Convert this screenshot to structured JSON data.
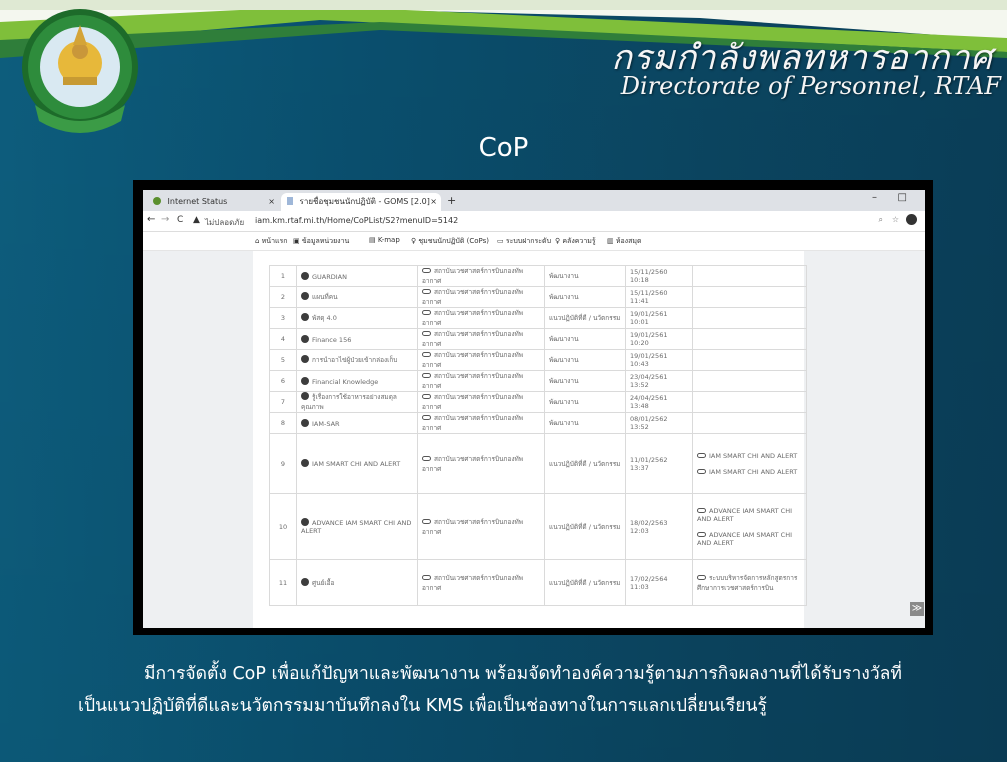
{
  "slide": {
    "org_name_th": "กรมกำลังพลทหารอากาศ",
    "org_name_en": "Directorate of Personnel, RTAF",
    "logo_ring_text": "กรมกำลังพลทหารอากาศ",
    "title": "CoP",
    "caption_line1": "มีการจัดตั้ง CoP เพื่อแก้ปัญหาและพัฒนางาน พร้อมจัดทำองค์ความรู้ตามภารกิจผลงานที่ได้รับรางวัลที่",
    "caption_line2": "เป็นแนวปฏิบัติที่ดีและนวัตกรรมมาบันทึกลงใน KMS  เพื่อเป็นช่องทางในการแลกเปลี่ยนเรียนรู้"
  },
  "browser": {
    "tabs": [
      {
        "label": "Internet Status",
        "close": "×"
      },
      {
        "label": "รายชื่อชุมชนนักปฏิบัติ - GOMS [2.0]",
        "close": "×"
      }
    ],
    "new_tab": "+",
    "window_min": "–",
    "window_max": "□",
    "nav_back": "←",
    "nav_forward": "→",
    "nav_reload": "C",
    "insecure_label": "ไม่ปลอดภัย",
    "url": "iam.km.rtaf.mi.th/Home/CoPList/S2?menuID=5142",
    "bookmarks": [
      "หน้าแรก",
      "ข้อมูลหน่วยงาน",
      "K-map",
      "ชุมชนนักปฏิบัติ (CoPs)",
      "ระบบฝากระดับ",
      "คลังความรู้",
      "ห้องสมุด"
    ],
    "scroll_top": "≫",
    "table_rows": [
      {
        "no": "1",
        "name": "GUARDIAN",
        "group": "สถาบันเวชศาสตร์การบินกองทัพอากาศ",
        "type": "พัฒนางาน",
        "date": "15/11/2560 10:18",
        "links": []
      },
      {
        "no": "2",
        "name": "แผนที่คน",
        "group": "สถาบันเวชศาสตร์การบินกองทัพอากาศ",
        "type": "พัฒนางาน",
        "date": "15/11/2560 11:41",
        "links": []
      },
      {
        "no": "3",
        "name": "พัสดุ 4.0",
        "group": "สถาบันเวชศาสตร์การบินกองทัพอากาศ",
        "type": "แนวปฏิบัติที่ดี / นวัตกรรม",
        "date": "19/01/2561 10:01",
        "links": []
      },
      {
        "no": "4",
        "name": "Finance 156",
        "group": "สถาบันเวชศาสตร์การบินกองทัพอากาศ",
        "type": "พัฒนางาน",
        "date": "19/01/2561 10:20",
        "links": []
      },
      {
        "no": "5",
        "name": "การนำอาไข่ผู้ป่วยเข้ากล่องเก็บ",
        "group": "สถาบันเวชศาสตร์การบินกองทัพอากาศ",
        "type": "พัฒนางาน",
        "date": "19/01/2561 10:43",
        "links": []
      },
      {
        "no": "6",
        "name": "Financial Knowledge",
        "group": "สถาบันเวชศาสตร์การบินกองทัพอากาศ",
        "type": "พัฒนางาน",
        "date": "23/04/2561 13:52",
        "links": []
      },
      {
        "no": "7",
        "name": "รู้เรื่องการใช้อาหารอย่างสมดุลคุณภาพ",
        "group": "สถาบันเวชศาสตร์การบินกองทัพอากาศ",
        "type": "พัฒนางาน",
        "date": "24/04/2561 13:48",
        "links": []
      },
      {
        "no": "8",
        "name": "IAM-SAR",
        "group": "สถาบันเวชศาสตร์การบินกองทัพอากาศ",
        "type": "พัฒนางาน",
        "date": "08/01/2562 13:52",
        "links": []
      },
      {
        "no": "9",
        "name": "IAM SMART CHI AND ALERT",
        "group": "สถาบันเวชศาสตร์การบินกองทัพอากาศ",
        "type": "แนวปฏิบัติที่ดี / นวัตกรรม",
        "date": "11/01/2562 13:37",
        "links": [
          "IAM SMART CHI AND ALERT",
          "IAM SMART CHI AND ALERT"
        ]
      },
      {
        "no": "10",
        "name": "ADVANCE IAM SMART CHI AND ALERT",
        "group": "สถาบันเวชศาสตร์การบินกองทัพอากาศ",
        "type": "แนวปฏิบัติที่ดี / นวัตกรรม",
        "date": "18/02/2563 12:03",
        "links": [
          "ADVANCE IAM SMART CHI AND ALERT",
          "ADVANCE IAM SMART CHI AND ALERT"
        ]
      },
      {
        "no": "11",
        "name": "ศูนย์เอื้อ",
        "group": "สถาบันเวชศาสตร์การบินกองทัพอากาศ",
        "type": "แนวปฏิบัติที่ดี / นวัตกรรม",
        "date": "17/02/2564 11:03",
        "links": [
          "ระบบบริหารจัดการหลักสูตรการศึกษาการเวชศาสตร์การบิน"
        ]
      }
    ]
  }
}
